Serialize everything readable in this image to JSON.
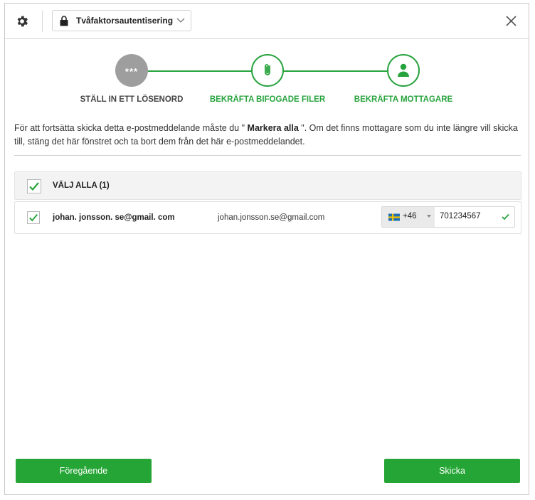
{
  "header": {
    "settings_icon": "gear-icon",
    "security_dropdown": {
      "icon": "lock-icon",
      "selected": "Tvåfaktorsautentisering"
    },
    "close_icon": "close-icon"
  },
  "stepper": {
    "steps": [
      {
        "label": "STÄLL IN ETT LÖSENORD",
        "icon_text": "***",
        "state": "completed"
      },
      {
        "label": "BEKRÄFTA BIFOGADE FILER",
        "icon": "paperclip-icon",
        "state": "active"
      },
      {
        "label": "BEKRÄFTA MOTTAGARE",
        "icon": "user-icon",
        "state": "active"
      }
    ]
  },
  "info": {
    "text_before": "För att fortsätta skicka detta e-postmeddelande måste du \"",
    "emphasis": " Markera alla ",
    "text_after": "\". Om det finns mottagare som du inte längre vill skicka till, stäng det här fönstret och ta bort dem från det här e-postmeddelandet."
  },
  "recipients": {
    "select_all_label": "VÄLJ ALLA (1)",
    "select_all_checked": true,
    "rows": [
      {
        "checked": true,
        "name": "johan. jonsson. se@gmail. com",
        "email": "johan.jonsson.se@gmail.com",
        "country_flag": "sweden-flag",
        "country_code": "+46",
        "phone": "701234567",
        "phone_valid": true
      }
    ]
  },
  "footer": {
    "previous_label": "Föregående",
    "send_label": "Skicka"
  },
  "colors": {
    "accent": "#27a33d",
    "button": "#25a535",
    "completed_step": "#9e9e9e"
  }
}
